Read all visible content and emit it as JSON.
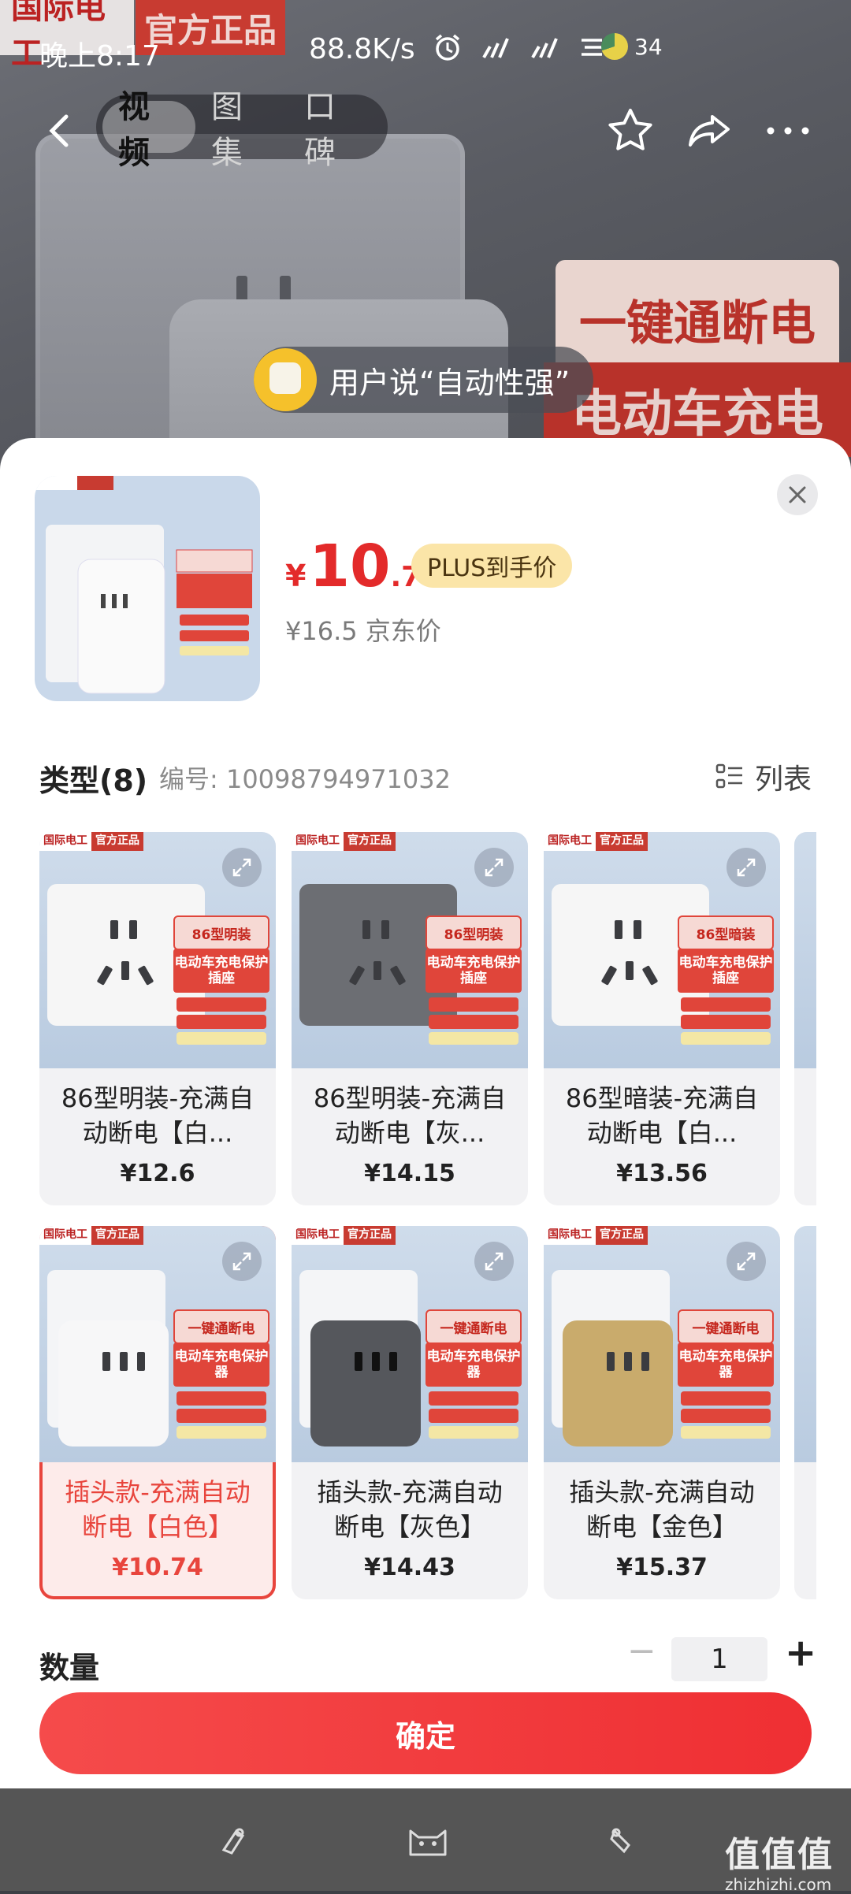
{
  "status_bar": {
    "time": "晚上8:17",
    "net_speed": "88.8K/s",
    "battery": "34"
  },
  "hero": {
    "brand_logo": "国际电工",
    "brand_badge": "官方正品",
    "promo_line1": "一键通断电",
    "promo_line2": "电动车充电"
  },
  "top_nav": {
    "tabs": [
      {
        "label": "视频",
        "active": true
      },
      {
        "label": "图集",
        "active": false
      },
      {
        "label": "口碑",
        "active": false
      }
    ]
  },
  "review_chip": {
    "text": "用户说“自动性强”"
  },
  "sheet": {
    "price": {
      "currency": "¥",
      "integer": "10",
      "decimal": ".74",
      "plus_tag": "PLUS到手价",
      "jd_price": "¥16.5 京东价"
    },
    "thumb": {
      "brand": "国际电工",
      "badge": "官方正品",
      "tag_a": "一键通断电",
      "tag_b": "电动车充电保护器"
    },
    "type": {
      "title": "类型(8)",
      "code": "编号: 10098794971032",
      "list_toggle": "列表"
    },
    "products": [
      {
        "label": "86型明装-充满自动断电【白...",
        "price": "¥12.6",
        "tag_a": "86型明装",
        "tag_b": "电动车充电保护插座",
        "selected": false
      },
      {
        "label": "86型明装-充满自动断电【灰...",
        "price": "¥14.15",
        "tag_a": "86型明装",
        "tag_b": "电动车充电保护插座",
        "selected": false
      },
      {
        "label": "86型暗装-充满自动断电【白...",
        "price": "¥13.56",
        "tag_a": "86型暗装",
        "tag_b": "电动车充电保护插座",
        "selected": false
      },
      {
        "label": "插头款-充满自动断电【白色】",
        "price": "¥10.74",
        "tag_a": "一键通断电",
        "tag_b": "电动车充电保护器",
        "selected": true
      },
      {
        "label": "插头款-充满自动断电【灰色】",
        "price": "¥14.43",
        "tag_a": "一键通断电",
        "tag_b": "电动车充电保护器",
        "selected": false
      },
      {
        "label": "插头款-充满自动断电【金色】",
        "price": "¥15.37",
        "tag_a": "一键通断电",
        "tag_b": "电动车充电保护器",
        "selected": false
      }
    ],
    "card_brand": "国际电工",
    "card_badge": "官方正品",
    "quantity": {
      "label": "数量",
      "minus": "−",
      "value": "1",
      "plus": "+"
    },
    "confirm_label": "确定"
  },
  "watermark": {
    "big": "值值值",
    "small": "zhizhizhi.com"
  },
  "colors": {
    "accent": "#e8453d",
    "price_red": "#e32a2a",
    "plus_tag_bg": "#fbe5a8"
  }
}
